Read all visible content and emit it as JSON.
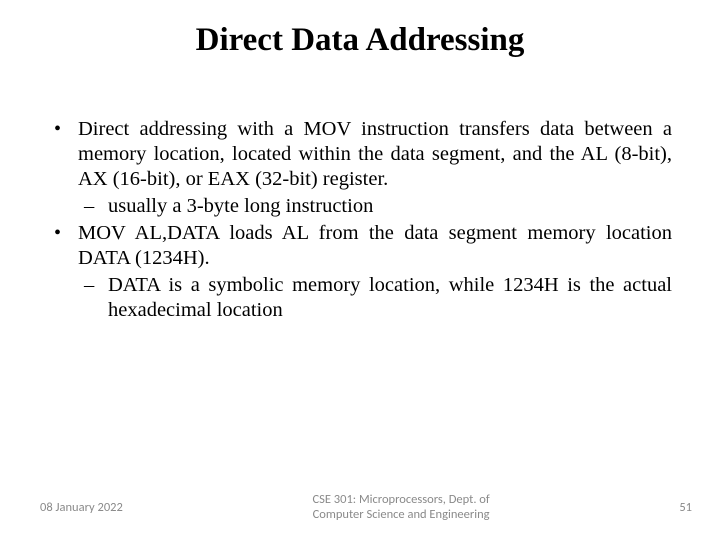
{
  "title": "Direct Data Addressing",
  "bullets": {
    "b1": "Direct addressing with a MOV instruction transfers data between a memory location, located within the data segment, and the AL (8-bit), AX (16-bit), or EAX (32-bit) register.",
    "b1_sub1": "usually a 3-byte long instruction",
    "b2": "MOV AL,DATA loads AL from the data segment memory location DATA (1234H).",
    "b2_sub1": "DATA is a symbolic memory location, while 1234H is the actual hexadecimal location"
  },
  "footer": {
    "date": "08 January 2022",
    "center1": "CSE 301: Microprocessors, Dept. of",
    "center2": "Computer Science and Engineering",
    "page": "51"
  }
}
